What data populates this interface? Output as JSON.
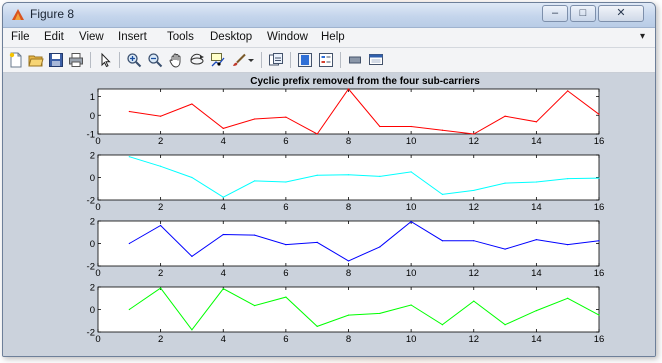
{
  "window": {
    "title": "Figure 8",
    "minimize_glyph": "–",
    "maximize_glyph": "□",
    "close_glyph": "✕"
  },
  "menu": [
    "File",
    "Edit",
    "View",
    "Insert",
    "Tools",
    "Desktop",
    "Window",
    "Help"
  ],
  "menu_overflow_glyph": "▾",
  "toolbar": {
    "icons": [
      "new-figure-icon",
      "open-file-icon",
      "save-icon",
      "print-icon",
      "pointer-icon",
      "zoom-in-icon",
      "zoom-out-icon",
      "pan-icon",
      "rotate-3d-icon",
      "data-cursor-icon",
      "brush-icon",
      "link-plot-icon",
      "colorbar-icon",
      "legend-icon",
      "hide-plot-tools-icon",
      "show-plot-tools-icon"
    ]
  },
  "chart_data": {
    "type": "line",
    "title": "Cyclic prefix removed from the four sub-carriers",
    "subplots": [
      {
        "color": "#ff0000",
        "x": [
          1,
          2,
          3,
          4,
          5,
          6,
          7,
          8,
          9,
          10,
          11,
          12,
          13,
          14,
          15,
          16
        ],
        "y": [
          0.2,
          -0.05,
          0.6,
          -0.7,
          -0.2,
          -0.1,
          -1.0,
          1.4,
          -0.6,
          -0.6,
          -0.8,
          -1.0,
          -0.05,
          -0.35,
          1.3,
          0.05
        ],
        "xlim": [
          0,
          16
        ],
        "ylim": [
          -1,
          1.4
        ],
        "yticks": [
          -1,
          0,
          1
        ],
        "xticks": [
          0,
          2,
          4,
          6,
          8,
          10,
          12,
          14,
          16
        ]
      },
      {
        "color": "#00ffff",
        "x": [
          1,
          2,
          3,
          4,
          5,
          6,
          7,
          8,
          9,
          10,
          11,
          12,
          13,
          14,
          15,
          16
        ],
        "y": [
          1.85,
          1.0,
          0.0,
          -1.75,
          -0.3,
          -0.4,
          0.2,
          0.25,
          0.1,
          0.5,
          -1.5,
          -1.15,
          -0.5,
          -0.4,
          -0.1,
          -0.05
        ],
        "xlim": [
          0,
          16
        ],
        "ylim": [
          -2,
          2
        ],
        "yticks": [
          -2,
          0,
          2
        ],
        "xticks": [
          0,
          2,
          4,
          6,
          8,
          10,
          12,
          14,
          16
        ]
      },
      {
        "color": "#0000ff",
        "x": [
          1,
          2,
          3,
          4,
          5,
          6,
          7,
          8,
          9,
          10,
          11,
          12,
          13,
          14,
          15,
          16
        ],
        "y": [
          0.0,
          1.6,
          -1.15,
          0.8,
          0.75,
          -0.1,
          0.1,
          -1.55,
          -0.3,
          1.95,
          0.25,
          0.25,
          -0.5,
          0.35,
          -0.1,
          0.25
        ],
        "xlim": [
          0,
          16
        ],
        "ylim": [
          -2,
          2
        ],
        "yticks": [
          -2,
          0,
          2
        ],
        "xticks": [
          0,
          2,
          4,
          6,
          8,
          10,
          12,
          14,
          16
        ]
      },
      {
        "color": "#00ff00",
        "x": [
          1,
          2,
          3,
          4,
          5,
          6,
          7,
          8,
          9,
          10,
          11,
          12,
          13,
          14,
          15,
          16
        ],
        "y": [
          0.0,
          1.9,
          -1.8,
          1.85,
          0.35,
          1.1,
          -1.5,
          -0.5,
          -0.35,
          0.4,
          -1.35,
          0.75,
          -1.35,
          -0.1,
          1.0,
          -0.5
        ],
        "xlim": [
          0,
          16
        ],
        "ylim": [
          -2,
          2
        ],
        "yticks": [
          -2,
          0,
          2
        ],
        "xticks": [
          0,
          2,
          4,
          6,
          8,
          10,
          12,
          14,
          16
        ]
      }
    ]
  }
}
